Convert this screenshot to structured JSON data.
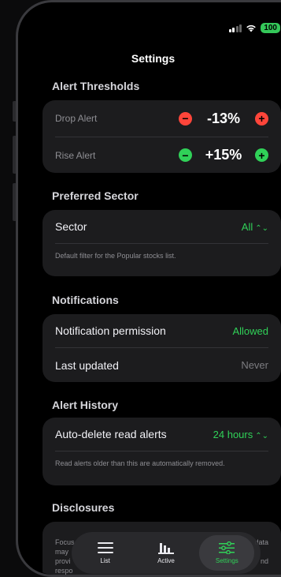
{
  "app": {
    "title": "Settings"
  },
  "status_bar": {
    "battery": "100"
  },
  "alert_thresholds": {
    "header": "Alert Thresholds",
    "drop": {
      "label": "Drop Alert",
      "value": "-13%"
    },
    "rise": {
      "label": "Rise Alert",
      "value": "+15%"
    }
  },
  "preferred_sector": {
    "header": "Preferred Sector",
    "label": "Sector",
    "value": "All",
    "footnote": "Default filter for the Popular stocks list."
  },
  "notifications": {
    "header": "Notifications",
    "permission_label": "Notification permission",
    "permission_value": "Allowed",
    "updated_label": "Last updated",
    "updated_value": "Never"
  },
  "alert_history": {
    "header": "Alert History",
    "label": "Auto-delete read alerts",
    "value": "24 hours",
    "footnote": "Read alerts older than this are automatically removed."
  },
  "disclosures": {
    "header": "Disclosures",
    "line1": "Focus",
    "line1_end": "data",
    "line2": "may",
    "line3": "provi",
    "line3_end": "nd",
    "line4": "respo"
  },
  "tabbar": {
    "items": [
      {
        "label": "List",
        "icon": "list-icon"
      },
      {
        "label": "Active",
        "icon": "bar-chart-icon"
      },
      {
        "label": "Settings",
        "icon": "sliders-icon"
      }
    ],
    "active": "Settings"
  },
  "colors": {
    "accent": "#30d158",
    "danger": "#ff453a",
    "card": "#1c1c1e"
  }
}
